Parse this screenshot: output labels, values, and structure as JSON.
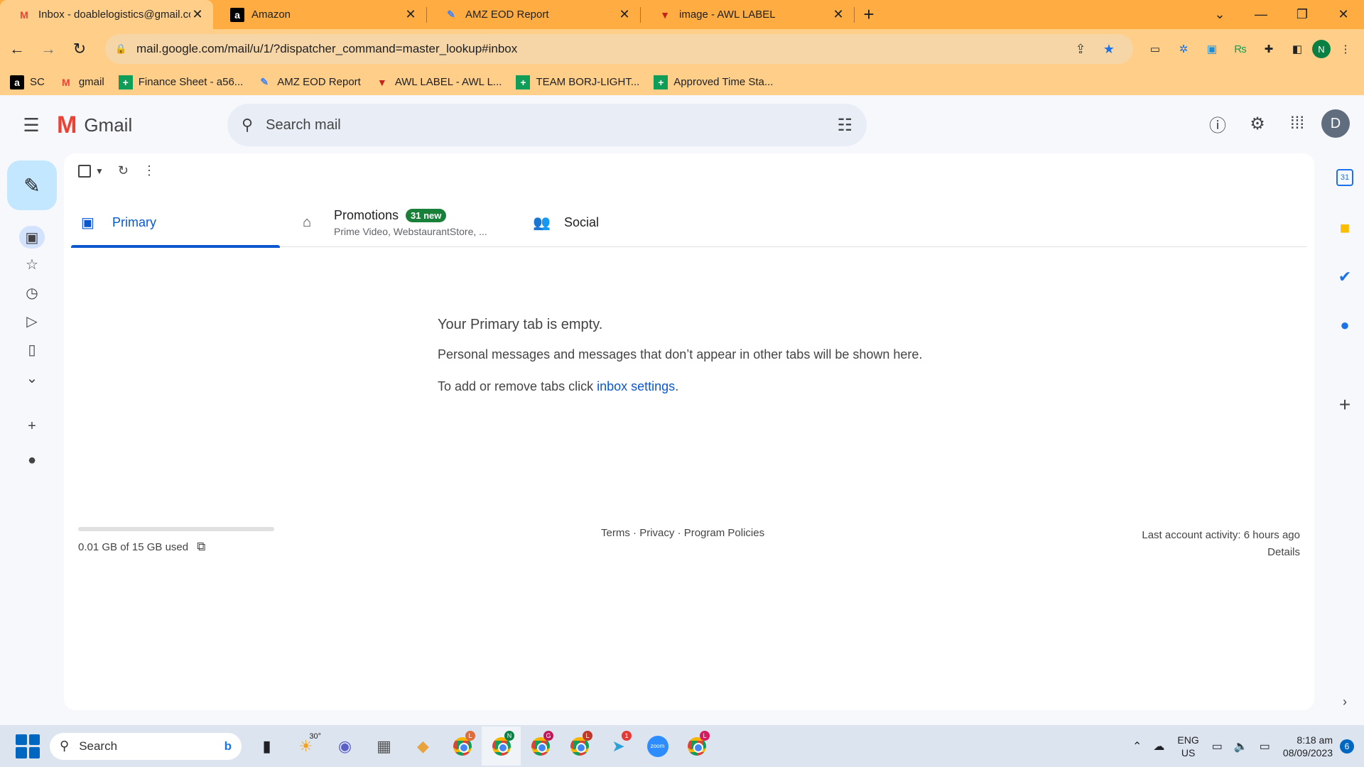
{
  "browser": {
    "tabs": [
      {
        "title": "Inbox - doablelogistics@gmail.co",
        "icon": "gmail-icon",
        "icon_glyph": "M"
      },
      {
        "title": "Amazon",
        "icon": "amazon-icon",
        "icon_glyph": "a"
      },
      {
        "title": "AMZ EOD Report",
        "icon": "report-icon",
        "icon_glyph": "✎"
      },
      {
        "title": "image - AWL LABEL",
        "icon": "awl-icon",
        "icon_glyph": "▼"
      }
    ],
    "new_tab": "+",
    "url": "mail.google.com/mail/u/1/?dispatcher_command=master_lookup#inbox",
    "profile_initial": "N",
    "bookmarks": [
      {
        "label": "SC",
        "glyph": "a"
      },
      {
        "label": "gmail",
        "glyph": "M"
      },
      {
        "label": "Finance Sheet - a56...",
        "glyph": "+"
      },
      {
        "label": "AMZ EOD Report",
        "glyph": "✎"
      },
      {
        "label": "AWL LABEL - AWL L...",
        "glyph": "▼"
      },
      {
        "label": "TEAM BORJ-LIGHT...",
        "glyph": "+"
      },
      {
        "label": "Approved Time Sta...",
        "glyph": "+"
      }
    ]
  },
  "gmail": {
    "logo_text": "Gmail",
    "search_placeholder": "Search mail",
    "account_initial": "D",
    "tabs": {
      "primary": "Primary",
      "promotions": "Promotions",
      "promotions_badge": "31 new",
      "promotions_sub": "Prime Video, WebstaurantStore, ...",
      "social": "Social"
    },
    "empty": {
      "title": "Your Primary tab is empty.",
      "line1": "Personal messages and messages that don’t appear in other tabs will be shown here.",
      "line2_prefix": "To add or remove tabs click ",
      "line2_link": "inbox settings",
      "line2_suffix": "."
    },
    "footer": {
      "storage": "0.01 GB of 15 GB used",
      "terms": "Terms",
      "privacy": "Privacy",
      "policies": "Program Policies",
      "last_activity": "Last account activity: 6 hours ago",
      "details": "Details"
    },
    "calendar_day": "31"
  },
  "taskbar": {
    "search_label": "Search",
    "weather": "30°",
    "lang1": "ENG",
    "lang2": "US",
    "time": "8:18 am",
    "date": "08/09/2023",
    "notifications": "6",
    "badges": [
      "L",
      "N",
      "G",
      "L",
      "1",
      "L"
    ]
  },
  "colors": {
    "accent": "#0b57d0",
    "tab_bar": "#ffad42",
    "badge_green": "#188038"
  }
}
